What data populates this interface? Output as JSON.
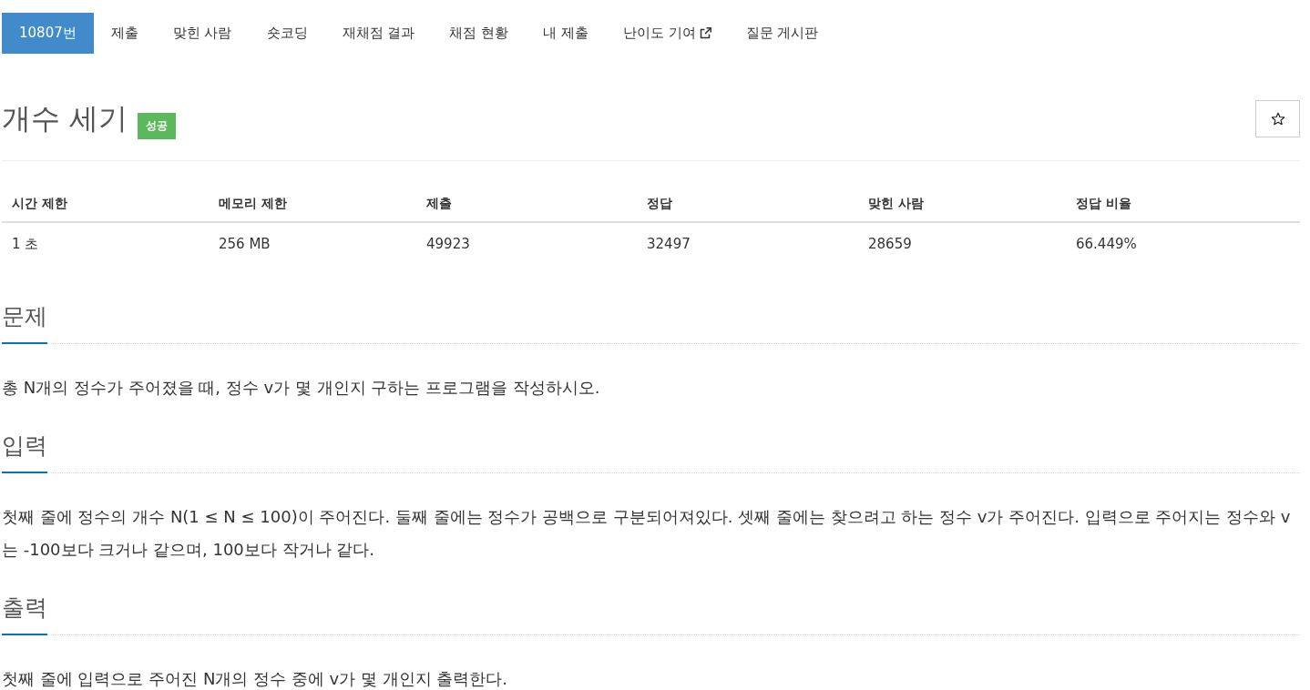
{
  "tabs": [
    {
      "label": "10807번",
      "selected": true,
      "external": false
    },
    {
      "label": "제출",
      "selected": false,
      "external": false
    },
    {
      "label": "맞힌 사람",
      "selected": false,
      "external": false
    },
    {
      "label": "숏코딩",
      "selected": false,
      "external": false
    },
    {
      "label": "재채점 결과",
      "selected": false,
      "external": false
    },
    {
      "label": "채점 현황",
      "selected": false,
      "external": false
    },
    {
      "label": "내 제출",
      "selected": false,
      "external": false
    },
    {
      "label": "난이도 기여",
      "selected": false,
      "external": true
    },
    {
      "label": "질문 게시판",
      "selected": false,
      "external": false
    }
  ],
  "problem": {
    "title": "개수 세기",
    "badge": "성공"
  },
  "info_table": {
    "columns": [
      "시간 제한",
      "메모리 제한",
      "제출",
      "정답",
      "맞힌 사람",
      "정답 비율"
    ],
    "rows": [
      [
        "1 초",
        "256 MB",
        "49923",
        "32497",
        "28659",
        "66.449%"
      ]
    ]
  },
  "sections": [
    {
      "heading": "문제",
      "paragraphs": [
        "총 N개의 정수가 주어졌을 때, 정수 v가 몇 개인지 구하는 프로그램을 작성하시오."
      ]
    },
    {
      "heading": "입력",
      "paragraphs": [
        "첫째 줄에 정수의 개수 N(1 ≤ N ≤ 100)이 주어진다. 둘째 줄에는 정수가 공백으로 구분되어져있다. 셋째 줄에는 찾으려고 하는 정수 v가 주어진다. 입력으로 주어지는 정수와 v는 -100보다 크거나 같으며, 100보다 작거나 같다."
      ]
    },
    {
      "heading": "출력",
      "paragraphs": [
        "첫째 줄에 입력으로 주어진 N개의 정수 중에 v가 몇 개인지 출력한다."
      ]
    }
  ]
}
